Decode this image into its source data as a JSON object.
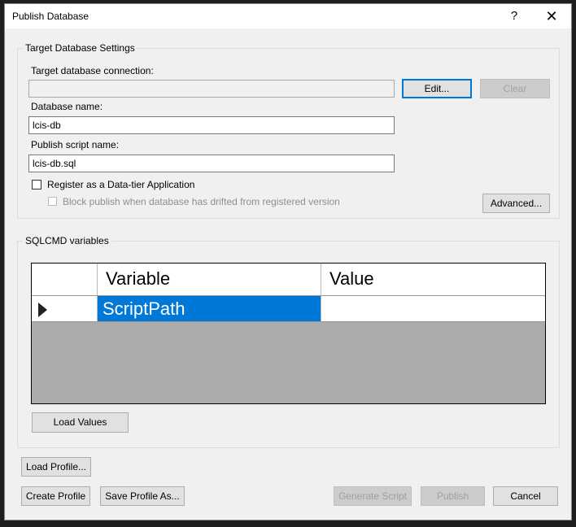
{
  "window": {
    "title": "Publish Database",
    "help": "?",
    "close": "✕"
  },
  "target_settings": {
    "group_label": "Target Database Settings",
    "connection_label": "Target database connection:",
    "connection_value": "",
    "edit_label": "Edit...",
    "clear_label": "Clear",
    "db_name_label": "Database name:",
    "db_name_value": "lcis-db",
    "script_name_label": "Publish script name:",
    "script_name_value": "lcis-db.sql",
    "register_label": "Register as a Data-tier Application",
    "block_label": "Block publish when database has drifted from registered version",
    "advanced_label": "Advanced..."
  },
  "sqlcmd": {
    "group_label": "SQLCMD variables",
    "columns": [
      "Variable",
      "Value"
    ],
    "rows": [
      {
        "variable": "ScriptPath",
        "value": ""
      }
    ],
    "load_values_label": "Load Values"
  },
  "footer": {
    "load_profile": "Load Profile...",
    "create_profile": "Create Profile",
    "save_profile_as": "Save Profile As...",
    "generate_script": "Generate Script",
    "publish": "Publish",
    "cancel": "Cancel"
  }
}
